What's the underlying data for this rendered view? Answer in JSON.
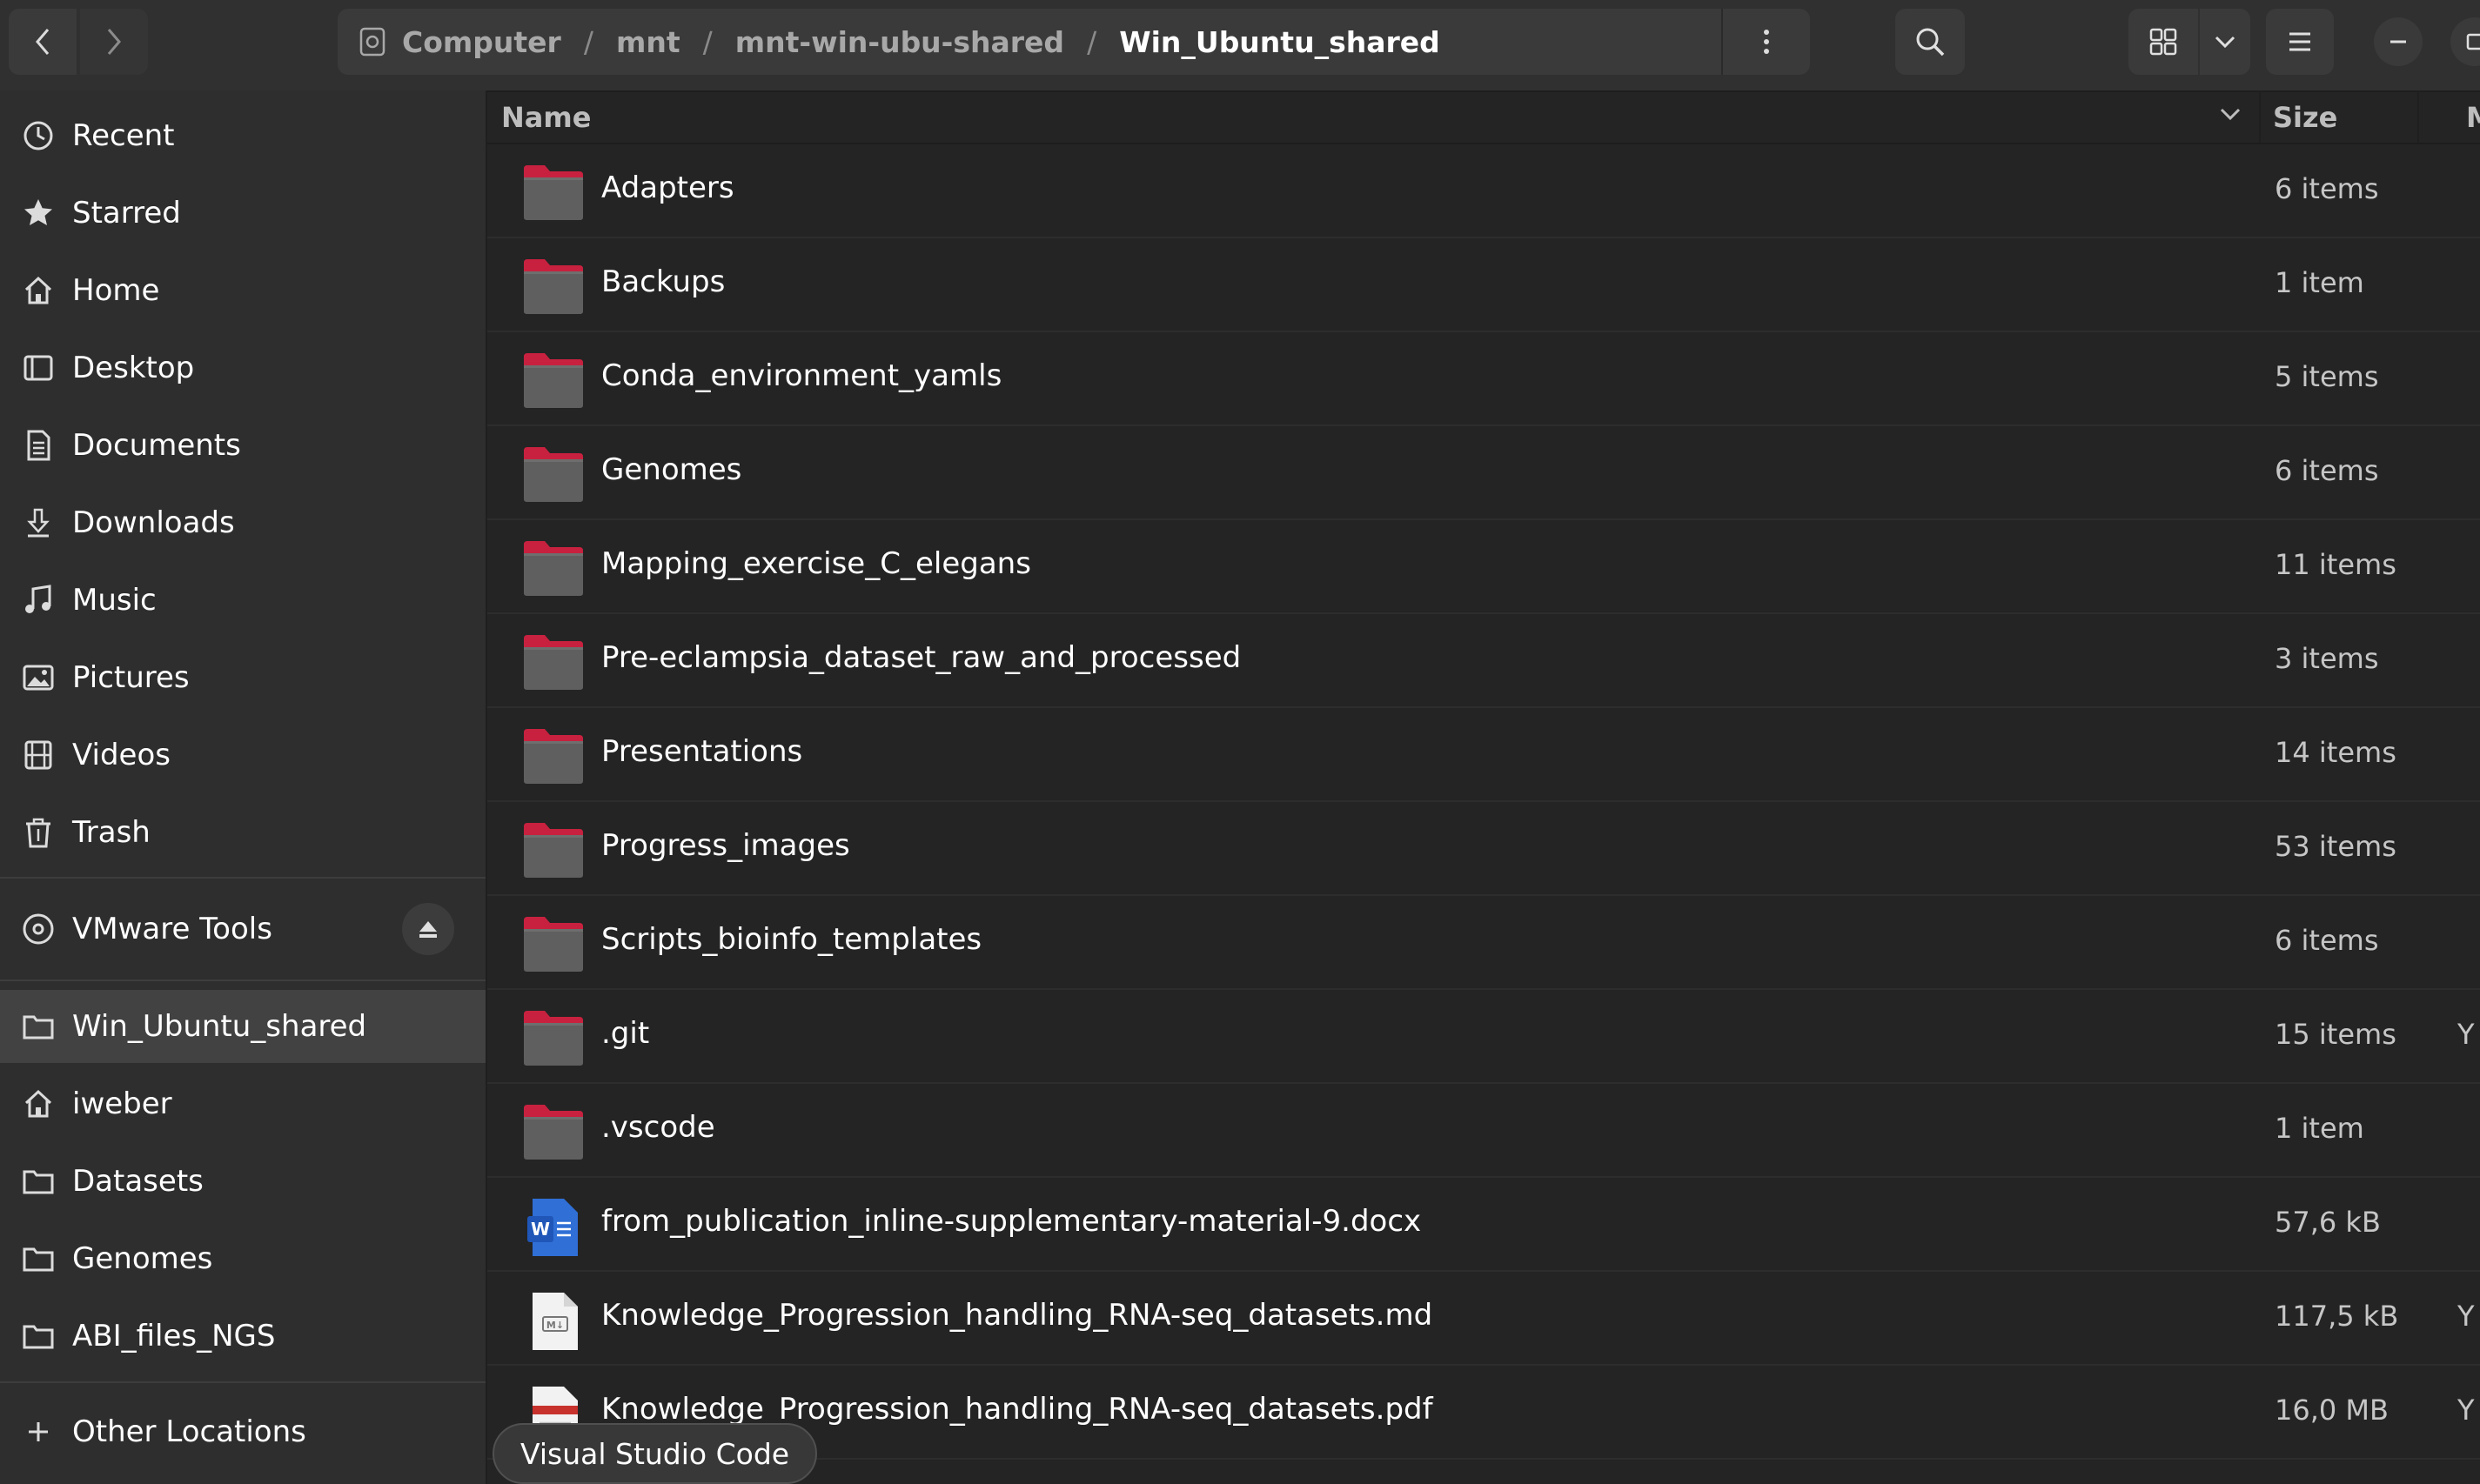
{
  "header": {
    "breadcrumbs": [
      {
        "label": "Computer"
      },
      {
        "label": "mnt"
      },
      {
        "label": "mnt-win-ubu-shared"
      },
      {
        "label": "Win_Ubuntu_shared"
      }
    ]
  },
  "sidebar": {
    "places": [
      {
        "label": "Recent",
        "icon": "clock-icon"
      },
      {
        "label": "Starred",
        "icon": "star-icon"
      },
      {
        "label": "Home",
        "icon": "home-icon"
      },
      {
        "label": "Desktop",
        "icon": "desktop-icon"
      },
      {
        "label": "Documents",
        "icon": "document-icon"
      },
      {
        "label": "Downloads",
        "icon": "download-icon"
      },
      {
        "label": "Music",
        "icon": "music-icon"
      },
      {
        "label": "Pictures",
        "icon": "picture-icon"
      },
      {
        "label": "Videos",
        "icon": "video-icon"
      },
      {
        "label": "Trash",
        "icon": "trash-icon"
      }
    ],
    "devices": [
      {
        "label": "VMware Tools",
        "icon": "disc-icon"
      }
    ],
    "bookmarks": [
      {
        "label": "Win_Ubuntu_shared",
        "icon": "folder-icon",
        "active": true
      },
      {
        "label": "iweber",
        "icon": "home-icon"
      },
      {
        "label": "Datasets",
        "icon": "folder-icon"
      },
      {
        "label": "Genomes",
        "icon": "folder-icon"
      },
      {
        "label": "ABI_files_NGS",
        "icon": "folder-icon"
      }
    ],
    "other": {
      "label": "Other Locations",
      "icon": "plus-icon"
    }
  },
  "list": {
    "columns": {
      "name": "Name",
      "size": "Size",
      "modified": "M"
    },
    "rows": [
      {
        "name": "Adapters",
        "size": "6 items",
        "type": "folder",
        "mod": ""
      },
      {
        "name": "Backups",
        "size": "1 item",
        "type": "folder",
        "mod": ""
      },
      {
        "name": "Conda_environment_yamls",
        "size": "5 items",
        "type": "folder",
        "mod": ""
      },
      {
        "name": "Genomes",
        "size": "6 items",
        "type": "folder",
        "mod": ""
      },
      {
        "name": "Mapping_exercise_C_elegans",
        "size": "11 items",
        "type": "folder",
        "mod": ""
      },
      {
        "name": "Pre-eclampsia_dataset_raw_and_processed",
        "size": "3 items",
        "type": "folder",
        "mod": ""
      },
      {
        "name": "Presentations",
        "size": "14 items",
        "type": "folder",
        "mod": ""
      },
      {
        "name": "Progress_images",
        "size": "53 items",
        "type": "folder",
        "mod": ""
      },
      {
        "name": "Scripts_bioinfo_templates",
        "size": "6 items",
        "type": "folder",
        "mod": ""
      },
      {
        "name": ".git",
        "size": "15 items",
        "type": "folder",
        "mod": "Y"
      },
      {
        "name": ".vscode",
        "size": "1 item",
        "type": "folder",
        "mod": ""
      },
      {
        "name": "from_publication_inline-supplementary-material-9.docx",
        "size": "57,6 kB",
        "type": "docx",
        "mod": ""
      },
      {
        "name": "Knowledge_Progression_handling_RNA-seq_datasets.md",
        "size": "117,5 kB",
        "type": "md",
        "mod": "Y"
      },
      {
        "name": "Knowledge_Progression_handling_RNA-seq_datasets.pdf",
        "size": "16,0 MB",
        "type": "pdf",
        "mod": "Y"
      }
    ]
  },
  "tooltip": "Visual Studio Code",
  "colors": {
    "folder": "#5f5f5f",
    "folder_tab": "#c7213f",
    "accent": "#e95420",
    "docx": "#2f6fd6"
  }
}
